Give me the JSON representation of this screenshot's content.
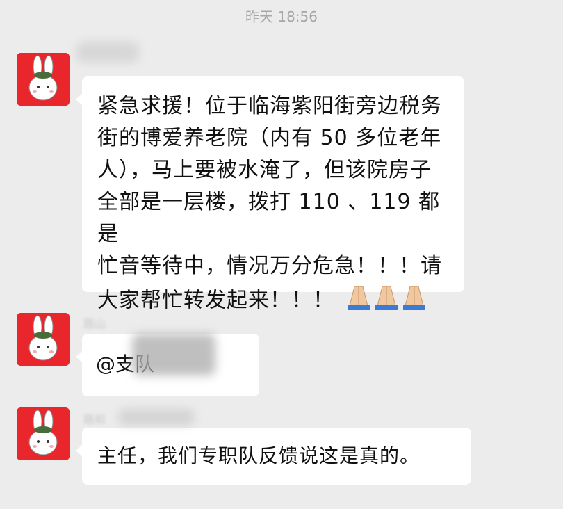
{
  "timestamp": "昨天 18:56",
  "messages": [
    {
      "sender": "",
      "lines": [
        "紧急求援！位于临海紫阳街旁边税务",
        "街的博爱养老院（内有 50 多位老年",
        "人），马上要被水淹了，但该院房子",
        "全部是一层楼，拨打 110 、119 都是",
        "忙音等待中，情况万分危急！！！请",
        "大家帮忙转发起来！！！"
      ],
      "emoji": "folded-hands-icon"
    },
    {
      "sender": "路山",
      "text": "@支队"
    },
    {
      "sender": "路和",
      "text": "主任，我们专职队反馈说这是真的。"
    }
  ],
  "colors": {
    "background": "#ececec",
    "bubble": "#ffffff",
    "avatar_bg": "#e8262c"
  }
}
